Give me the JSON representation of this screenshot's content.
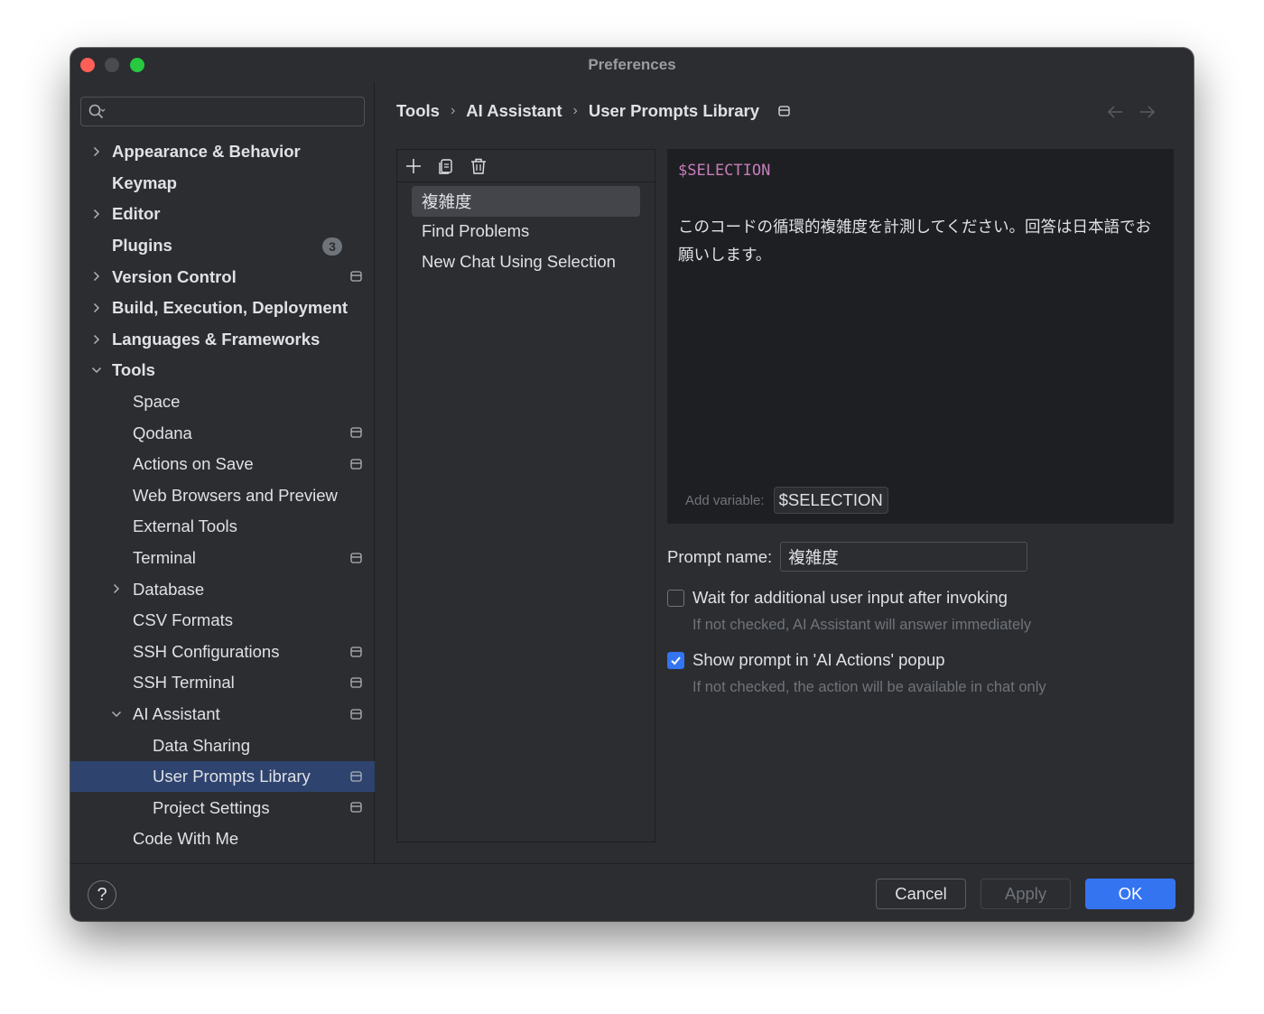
{
  "window": {
    "title": "Preferences"
  },
  "search": {
    "placeholder": "",
    "value": ""
  },
  "sidebar": {
    "items": [
      {
        "label": "Appearance & Behavior",
        "bold": true,
        "level": 0,
        "chevron": "right"
      },
      {
        "label": "Keymap",
        "bold": true,
        "level": 0,
        "chevron": "none"
      },
      {
        "label": "Editor",
        "bold": true,
        "level": 0,
        "chevron": "right"
      },
      {
        "label": "Plugins",
        "bold": true,
        "level": 0,
        "chevron": "none",
        "badge": "3"
      },
      {
        "label": "Version Control",
        "bold": true,
        "level": 0,
        "chevron": "right",
        "project": true
      },
      {
        "label": "Build, Execution, Deployment",
        "bold": true,
        "level": 0,
        "chevron": "right"
      },
      {
        "label": "Languages & Frameworks",
        "bold": true,
        "level": 0,
        "chevron": "right"
      },
      {
        "label": "Tools",
        "bold": true,
        "level": 0,
        "chevron": "down"
      },
      {
        "label": "Space",
        "level": 1,
        "chevron": "none"
      },
      {
        "label": "Qodana",
        "level": 1,
        "chevron": "none",
        "project": true
      },
      {
        "label": "Actions on Save",
        "level": 1,
        "chevron": "none",
        "project": true
      },
      {
        "label": "Web Browsers and Preview",
        "level": 1,
        "chevron": "none"
      },
      {
        "label": "External Tools",
        "level": 1,
        "chevron": "none"
      },
      {
        "label": "Terminal",
        "level": 1,
        "chevron": "none",
        "project": true
      },
      {
        "label": "Database",
        "level": 1,
        "chevron": "right"
      },
      {
        "label": "CSV Formats",
        "level": 1,
        "chevron": "none"
      },
      {
        "label": "SSH Configurations",
        "level": 1,
        "chevron": "none",
        "project": true
      },
      {
        "label": "SSH Terminal",
        "level": 1,
        "chevron": "none",
        "project": true
      },
      {
        "label": "AI Assistant",
        "level": 1,
        "chevron": "down",
        "project": true
      },
      {
        "label": "Data Sharing",
        "level": 2,
        "chevron": "none"
      },
      {
        "label": "User Prompts Library",
        "level": 2,
        "chevron": "none",
        "project": true,
        "selected": true
      },
      {
        "label": "Project Settings",
        "level": 2,
        "chevron": "none",
        "project": true
      },
      {
        "label": "Code With Me",
        "level": 1,
        "chevron": "none"
      }
    ]
  },
  "breadcrumb": {
    "items": [
      "Tools",
      "AI Assistant",
      "User Prompts Library"
    ],
    "separator": "›"
  },
  "prompts": {
    "items": [
      {
        "label": "複雑度",
        "selected": true
      },
      {
        "label": "Find Problems"
      },
      {
        "label": "New Chat Using Selection"
      }
    ]
  },
  "editor": {
    "variable_line": "$SELECTION",
    "text": "このコードの循環的複雑度を計測してください。回答は日本語でお願いします。",
    "add_variable_label": "Add variable:",
    "variable_chip": "$SELECTION"
  },
  "form": {
    "prompt_name_label": "Prompt name:",
    "prompt_name_value": "複雑度",
    "wait_input_label": "Wait for additional user input after invoking",
    "wait_input_checked": false,
    "wait_input_hint": "If not checked, AI Assistant will answer immediately",
    "show_popup_label": "Show prompt in 'AI Actions' popup",
    "show_popup_checked": true,
    "show_popup_hint": "If not checked, the action will be available in chat only"
  },
  "footer": {
    "help_label": "?",
    "cancel_label": "Cancel",
    "apply_label": "Apply",
    "ok_label": "OK"
  },
  "colors": {
    "accent": "#3574f0",
    "selection": "#2e436e",
    "variable": "#c77dbb",
    "background": "#2b2d30",
    "editor_background": "#1e1f22"
  }
}
